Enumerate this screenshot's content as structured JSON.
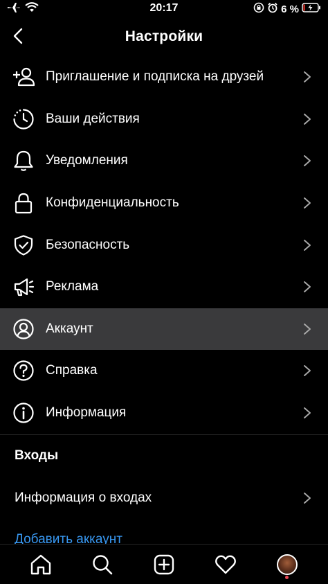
{
  "status": {
    "time": "20:17",
    "battery": "6 %",
    "airplane_icon": "airplane-icon",
    "wifi_icon": "wifi-icon"
  },
  "header": {
    "title": "Настройки",
    "back_icon": "chevron-left-icon"
  },
  "menu": {
    "items": [
      {
        "label": "Приглашение и подписка на друзей",
        "icon": "add-person-icon"
      },
      {
        "label": "Ваши действия",
        "icon": "activity-clock-icon"
      },
      {
        "label": "Уведомления",
        "icon": "bell-icon"
      },
      {
        "label": "Конфиденциальность",
        "icon": "lock-icon"
      },
      {
        "label": "Безопасность",
        "icon": "shield-check-icon"
      },
      {
        "label": "Реклама",
        "icon": "megaphone-icon"
      },
      {
        "label": "Аккаунт",
        "icon": "person-circle-icon",
        "selected": true
      },
      {
        "label": "Справка",
        "icon": "help-circle-icon"
      },
      {
        "label": "Информация",
        "icon": "info-circle-icon"
      }
    ]
  },
  "logins": {
    "section_title": "Входы",
    "login_info_label": "Информация о входах",
    "add_account_label": "Добавить аккаунт"
  },
  "tab_bar": {
    "tabs": [
      "home-icon",
      "search-icon",
      "new-post-icon",
      "heart-icon",
      "profile-avatar"
    ]
  },
  "colors": {
    "background": "#000000",
    "selected_row": "#3a3a3c",
    "link": "#3897f0",
    "notification": "#ed4956"
  }
}
